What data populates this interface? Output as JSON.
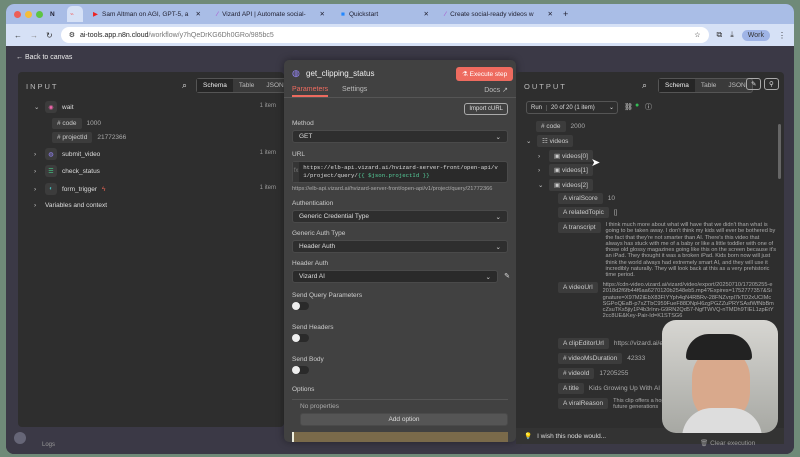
{
  "browser": {
    "tabs": [
      {
        "label": "N"
      },
      {
        "label": "n8n"
      },
      {
        "label": "Sam Altman on AGI, GPT-5, a"
      },
      {
        "label": "Vizard API | Automate social-"
      },
      {
        "label": "Quickstart"
      },
      {
        "label": "Create social-ready videos w"
      }
    ],
    "url_host": "ai-tools.app.n8n.cloud",
    "url_path": "/workflow/y7hQeDrKG6Dh0GRo/985bc5",
    "profile": "Work"
  },
  "back": "Back to canvas",
  "input": {
    "title": "INPUT",
    "views": [
      "Schema",
      "Table",
      "JSON"
    ],
    "nodes": [
      {
        "name": "wait",
        "count": "1 item",
        "fields": [
          {
            "key": "code",
            "value": "1000"
          },
          {
            "key": "projectId",
            "value": "21772366"
          }
        ]
      },
      {
        "name": "submit_video",
        "count": "1 item"
      },
      {
        "name": "check_status",
        "count": ""
      },
      {
        "name": "form_trigger",
        "count": "1 item"
      }
    ],
    "variables": "Variables and context"
  },
  "node": {
    "title": "get_clipping_status",
    "execute": "Execute step",
    "tabs": [
      "Parameters",
      "Settings"
    ],
    "docs": "Docs",
    "import": "Import cURL",
    "method_label": "Method",
    "method": "GET",
    "url_label": "URL",
    "url_static": "https://elb-api.vizard.ai/hvizard-server-front/open-api/v1/project/query/",
    "url_expr": "{{ $json.projectId }}",
    "url_preview": "https://elb-api.vizard.ai/hvizard-server-front/open-api/v1/project/query/21772366",
    "auth_label": "Authentication",
    "auth": "Generic Credential Type",
    "gauth_label": "Generic Auth Type",
    "gauth": "Header Auth",
    "hauth_label": "Header Auth",
    "hauth": "Vizard AI",
    "sqp": "Send Query Parameters",
    "sh": "Send Headers",
    "sb": "Send Body",
    "options": "Options",
    "noprops": "No properties",
    "addopt": "Add option"
  },
  "output": {
    "title": "OUTPUT",
    "views": [
      "Schema",
      "Table",
      "JSON"
    ],
    "run_label": "Run",
    "run": "20 of 20 (1 item)",
    "code_key": "code",
    "code": "2000",
    "videos": "videos",
    "v0": "videos[0]",
    "v1": "videos[1]",
    "v2": "videos[2]",
    "fields": [
      {
        "t": "A",
        "key": "viralScore",
        "value": "10"
      },
      {
        "t": "A",
        "key": "relatedTopic",
        "value": "[]"
      },
      {
        "t": "A",
        "key": "transcript",
        "value": "I think much more about what will have that we didn't than what is going to be taken away. I don't think my kids will ever be bothered by the fact that they're not smarter than AI. There's this video that always has stuck with me of a baby or like a little toddler with one of those old glossy magazines going like this on the screen because it's an iPad. They thought it was a broken iPad. Kids born now will just think the world always had extremely smart AI, and they will use it incredibly naturally. They will look back at this as a very prehistoric time period."
      },
      {
        "t": "A",
        "key": "videoUrl",
        "value": "https://cdn-video.vizard.ai/vizard/video/export/20250710/17205255-e2018d2f6fb44f6aa6270120b2548eb5.mp4?Expires=1752777357&Signature=X97M2iEbX83FIYYph4qN4RBRv-28FNZvrpl7kTD2xUCIMcSGPoQEaB-p7xZTbC959FueF88DNpH6zgPGZZuPRYSAsfWfNbBmcZsuTKs5jiy1P4b3rInn-G9RN2Qd57-NgfTWVQ-nTMDh9TIEL1zpEtY2cc8UE&Key-Pair-Id=K1STSG6"
      },
      {
        "t": "A",
        "key": "clipEditorUrl",
        "value": "https://vizard.ai/editor"
      },
      {
        "t": "#",
        "key": "videoMsDuration",
        "value": "42333"
      },
      {
        "t": "#",
        "key": "videoId",
        "value": "17205255"
      },
      {
        "t": "A",
        "key": "title",
        "value": "Kids Growing Up With AI Will"
      },
      {
        "t": "A",
        "key": "viralReason",
        "value": "This clip offers a hopeful impact on future generations"
      }
    ],
    "wish": "I wish this node would...",
    "clear": "Clear execution"
  },
  "logs": "Logs"
}
